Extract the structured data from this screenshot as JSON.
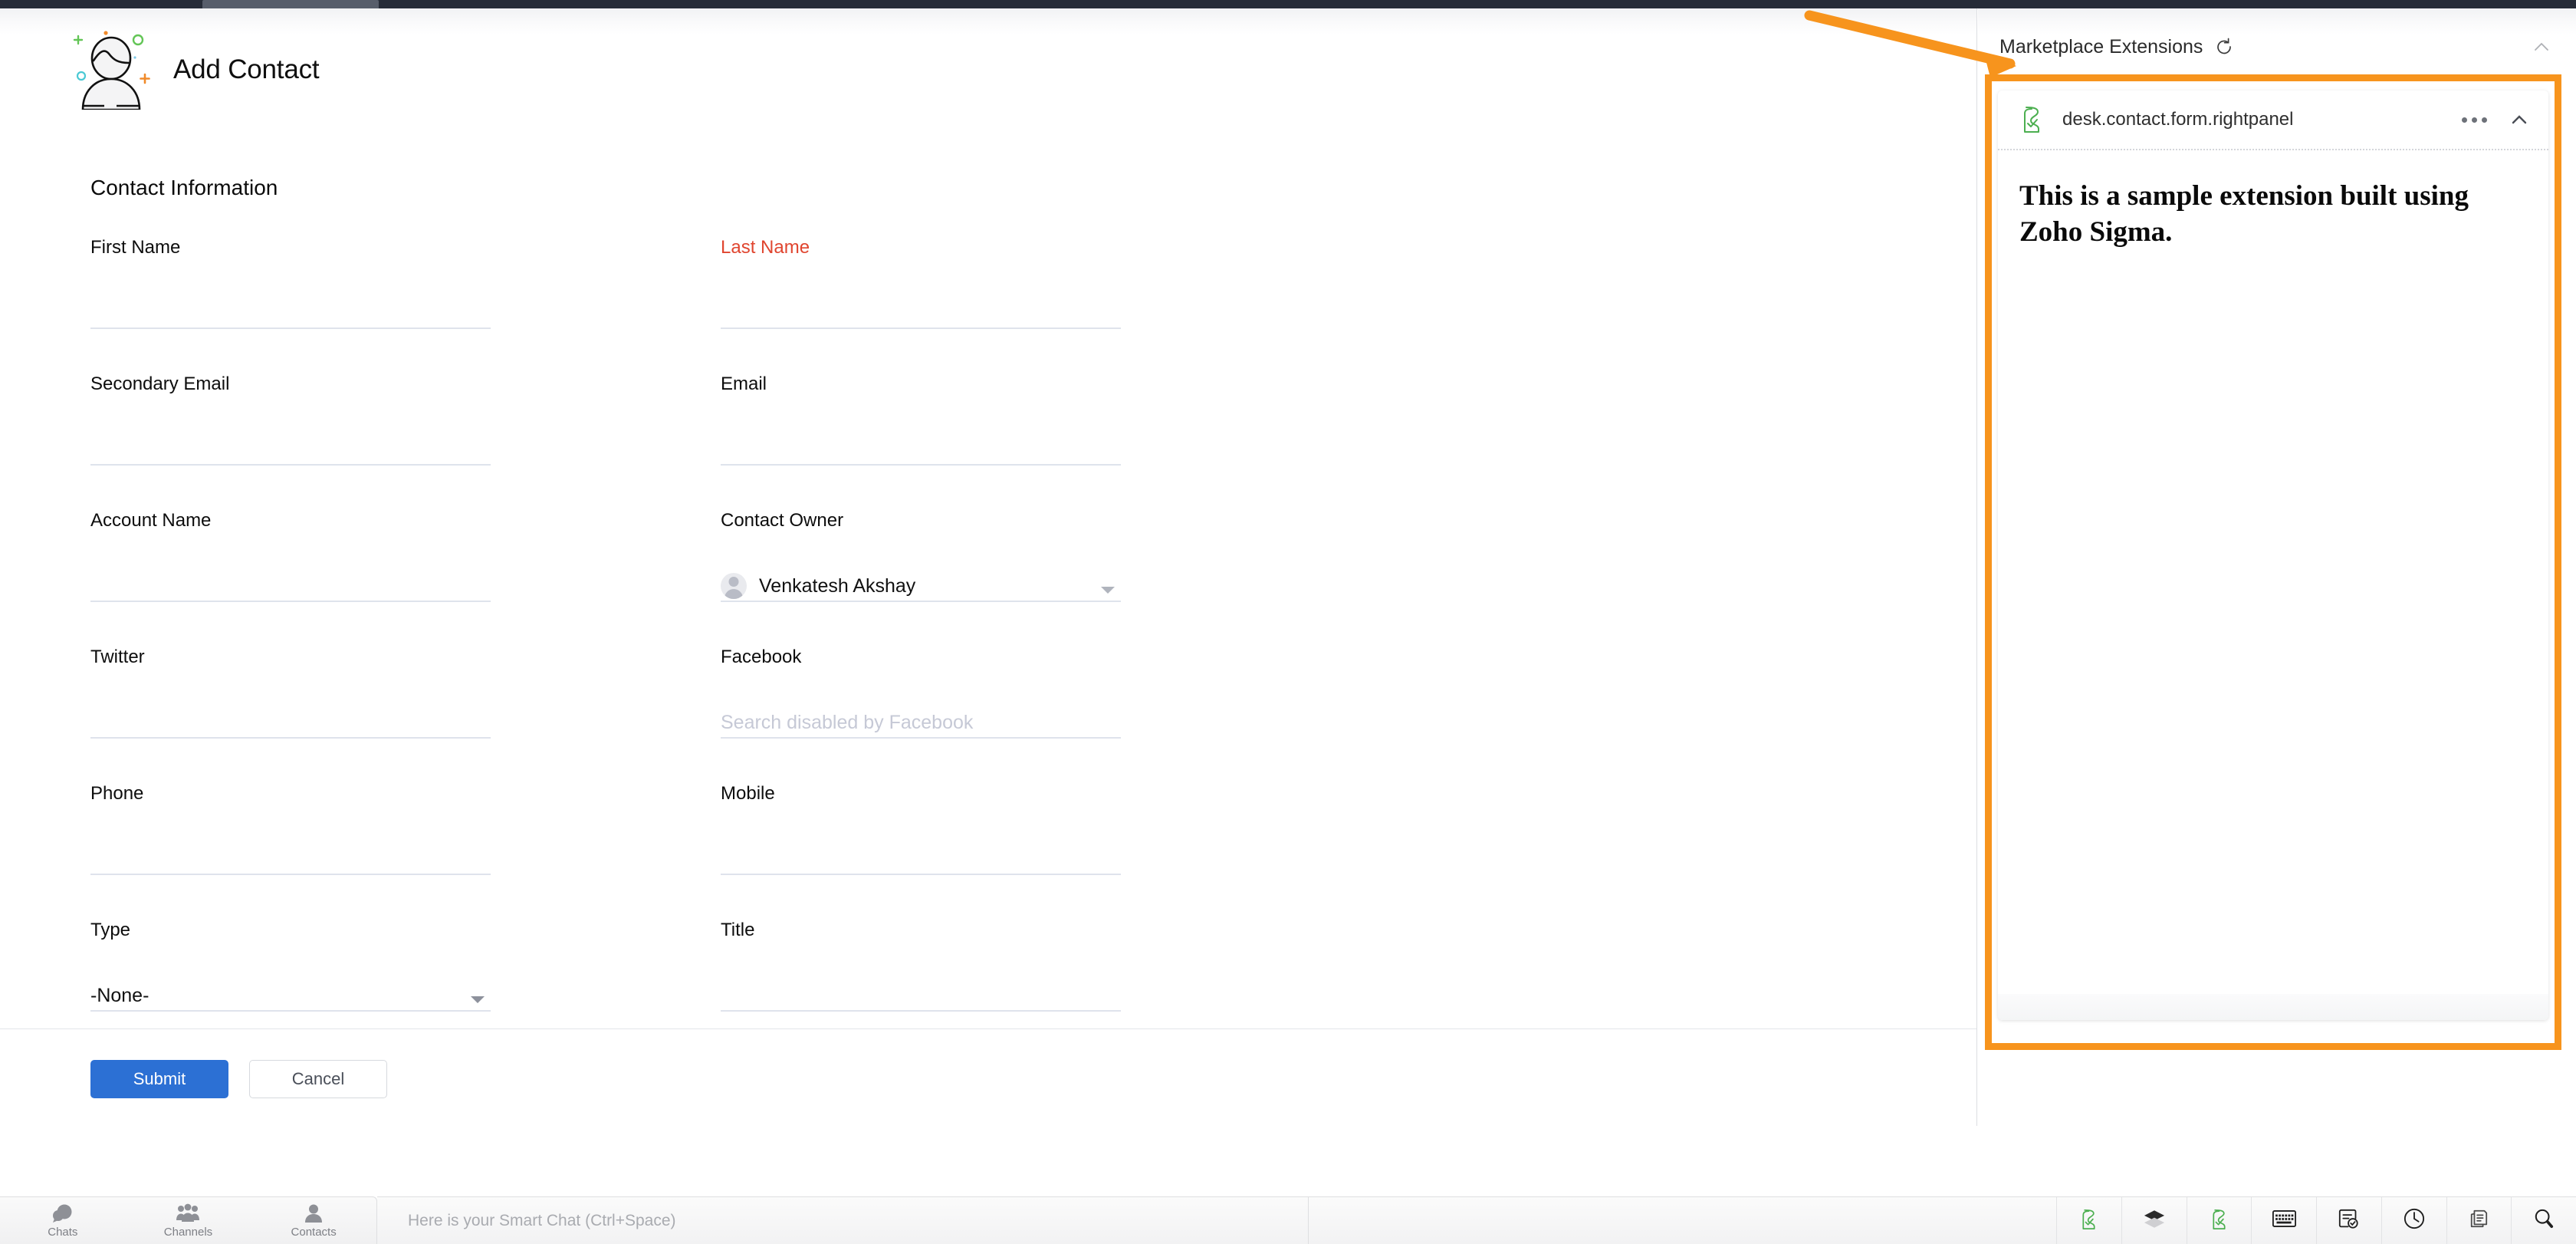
{
  "window": {
    "chrome_color": "#262c38",
    "tab_color": "#575e6b"
  },
  "header": {
    "title": "Add Contact",
    "avatar_icon": "add-contact-illustration"
  },
  "form": {
    "section_title": "Contact Information",
    "rows": [
      {
        "left": {
          "label": "First Name",
          "value": "",
          "placeholder": "",
          "required": false,
          "type": "text"
        },
        "right": {
          "label": "Last Name",
          "value": "",
          "placeholder": "",
          "required": true,
          "type": "text"
        }
      },
      {
        "left": {
          "label": "Secondary Email",
          "value": "",
          "placeholder": "",
          "required": false,
          "type": "text"
        },
        "right": {
          "label": "Email",
          "value": "",
          "placeholder": "",
          "required": false,
          "type": "text"
        }
      },
      {
        "left": {
          "label": "Account Name",
          "value": "",
          "placeholder": "",
          "required": false,
          "type": "text"
        },
        "right": {
          "label": "Contact Owner",
          "value": "Venkatesh Akshay",
          "placeholder": "",
          "required": false,
          "type": "owner-select"
        }
      },
      {
        "left": {
          "label": "Twitter",
          "value": "",
          "placeholder": "",
          "required": false,
          "type": "text"
        },
        "right": {
          "label": "Facebook",
          "value": "",
          "placeholder": "Search disabled by Facebook",
          "required": false,
          "type": "text"
        }
      },
      {
        "left": {
          "label": "Phone",
          "value": "",
          "placeholder": "",
          "required": false,
          "type": "text"
        },
        "right": {
          "label": "Mobile",
          "value": "",
          "placeholder": "",
          "required": false,
          "type": "text"
        }
      },
      {
        "left": {
          "label": "Type",
          "value": "-None-",
          "placeholder": "",
          "required": false,
          "type": "select"
        },
        "right": {
          "label": "Title",
          "value": "",
          "placeholder": "",
          "required": false,
          "type": "text"
        }
      }
    ],
    "submit_label": "Submit",
    "cancel_label": "Cancel",
    "submit_color": "#2c70d4",
    "required_color": "#e0452f"
  },
  "right_panel": {
    "title": "Marketplace Extensions",
    "refresh_icon": "refresh-icon",
    "collapse_icon": "chevron-up-icon",
    "highlight_color": "#F7941D",
    "extension": {
      "name": "desk.contact.form.rightpanel",
      "icon": "sigma-extension-icon",
      "more_icon": "more-options-icon",
      "collapse_icon": "chevron-up-icon",
      "body_text": "This is a sample extension built using Zoho Sigma."
    }
  },
  "annotation": {
    "arrow_icon": "orange-pointer-arrow",
    "arrow_color": "#F7941D"
  },
  "taskbar": {
    "items": [
      {
        "label": "Chats",
        "icon": "chats-icon"
      },
      {
        "label": "Channels",
        "icon": "channels-icon"
      },
      {
        "label": "Contacts",
        "icon": "contacts-icon"
      }
    ],
    "smart_chat_placeholder": "Here is your Smart Chat (Ctrl+Space)",
    "right_icons": [
      "sigma-extension-icon",
      "layers-icon",
      "sigma-extension-icon",
      "keyboard-icon",
      "task-check-icon",
      "clock-icon",
      "clipboard-icon",
      "search-icon"
    ]
  }
}
